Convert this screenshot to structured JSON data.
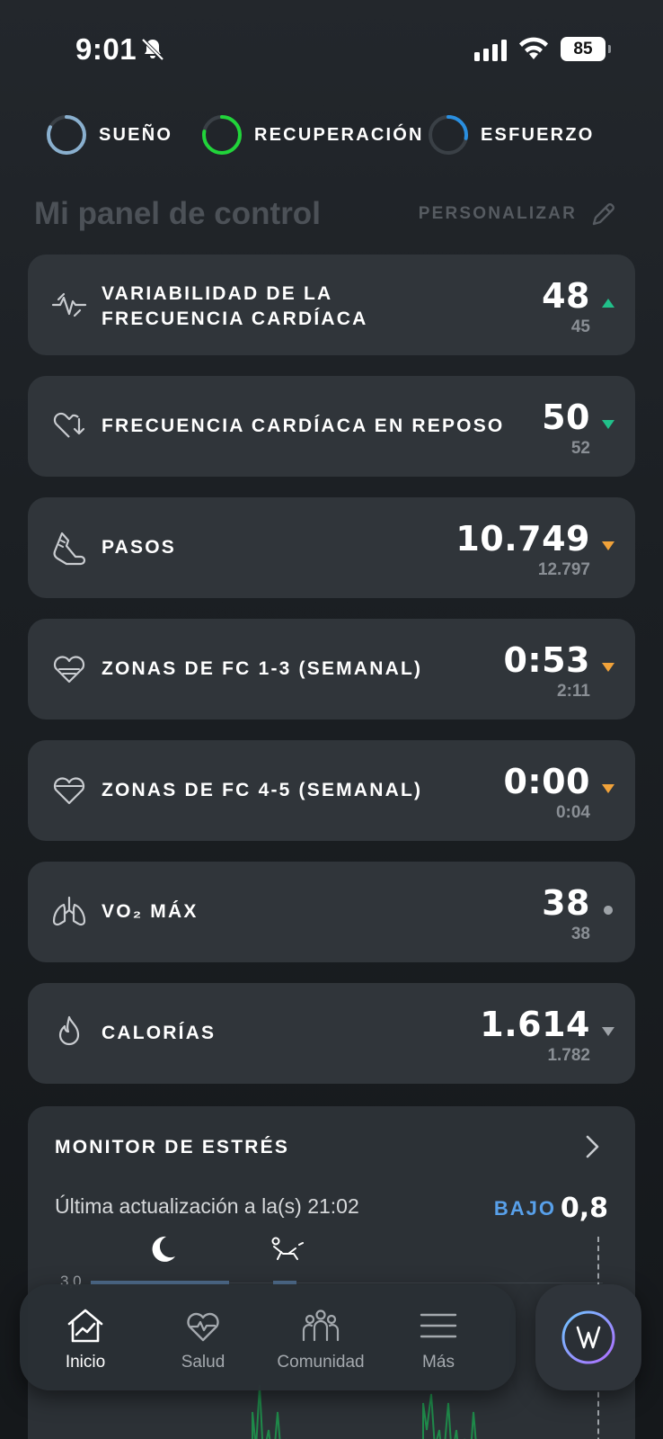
{
  "status_bar": {
    "time": "9:01",
    "battery": "85"
  },
  "rings": [
    {
      "label": "SUEÑO",
      "color": "#8ab0cf",
      "progress": 0.82
    },
    {
      "label": "RECUPERACIÓN",
      "color": "#21d43a",
      "progress": 0.78
    },
    {
      "label": "ESFUERZO",
      "color": "#2a8fe0",
      "progress": 0.28
    }
  ],
  "dashboard": {
    "title": "Mi panel de control",
    "customize_label": "PERSONALIZAR"
  },
  "metrics": [
    {
      "line1": "VARIABILIDAD DE LA",
      "line2": "FRECUENCIA CARDÍACA",
      "value": "48",
      "sub": "45",
      "trend": "up",
      "trend_color": "#21c08a",
      "icon": "hrv-icon"
    },
    {
      "line1": "FRECUENCIA CARDÍACA EN REPOSO",
      "line2": "",
      "value": "50",
      "sub": "52",
      "trend": "down",
      "trend_color": "#21c08a",
      "icon": "resting-heart-icon"
    },
    {
      "line1": "PASOS",
      "line2": "",
      "value": "10.749",
      "sub": "12.797",
      "trend": "down",
      "trend_color": "#f0a23a",
      "icon": "shoe-icon"
    },
    {
      "line1": "ZONAS DE FC 1-3 (SEMANAL)",
      "line2": "",
      "value": "0:53",
      "sub": "2:11",
      "trend": "down",
      "trend_color": "#f0a23a",
      "icon": "heart-zones-low-icon"
    },
    {
      "line1": "ZONAS DE FC 4-5 (SEMANAL)",
      "line2": "",
      "value": "0:00",
      "sub": "0:04",
      "trend": "down",
      "trend_color": "#f0a23a",
      "icon": "heart-zones-high-icon"
    },
    {
      "line1": "VO₂ MÁX",
      "line2": "",
      "value": "38",
      "sub": "38",
      "trend": "none",
      "trend_color": "#9ea3a8",
      "icon": "lungs-icon"
    },
    {
      "line1": "CALORÍAS",
      "line2": "",
      "value": "1.614",
      "sub": "1.782",
      "trend": "down",
      "trend_color": "#9ea3a8",
      "icon": "flame-icon"
    }
  ],
  "stress": {
    "title": "MONITOR DE ESTRÉS",
    "updated": "Última actualización a la(s) 21:02",
    "level": "BAJO",
    "value": "0,8",
    "axis_top": "3,0",
    "level_color": "#58a0ea"
  },
  "nav": {
    "items": [
      {
        "label": "Inicio",
        "icon": "home-chart-icon",
        "active": true
      },
      {
        "label": "Salud",
        "icon": "heart-pulse-icon",
        "active": false
      },
      {
        "label": "Comunidad",
        "icon": "community-icon",
        "active": false
      },
      {
        "label": "Más",
        "icon": "menu-icon",
        "active": false
      }
    ]
  }
}
